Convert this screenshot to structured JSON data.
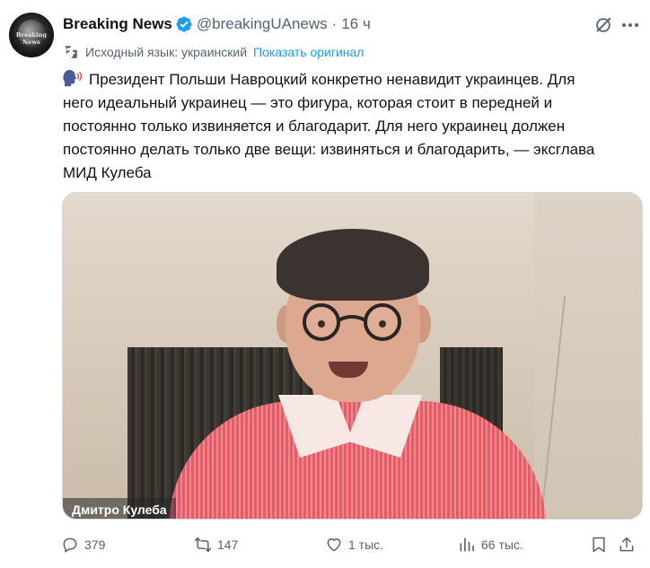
{
  "author": {
    "avatar_text": "Breaking News",
    "name": "Breaking News",
    "handle": "@breakingUAnews",
    "separator": "·",
    "time": "16 ч"
  },
  "translation": {
    "label": "Исходный язык: украинский",
    "show_original": "Показать оригинал"
  },
  "tweet": {
    "lines": [
      "Президент Польши Навроцкий конкретно ненавидит украинцев. Для",
      "него идеальный украинец — это фигура, которая стоит в передней и",
      "постоянно только извиняется и благодарит. Для него украинец должен",
      "постоянно делать только две вещи: извиняться и благодарить, — экс­глава",
      "МИД Кулеба"
    ]
  },
  "media": {
    "caption": "Дмитро Кулеба"
  },
  "actions": {
    "replies": "379",
    "reposts": "147",
    "likes": "1 тыс.",
    "views": "66 тыс."
  },
  "colors": {
    "text": "#0f1419",
    "secondary": "#536471",
    "link": "#1d9bf0",
    "verified": "#1d9bf0"
  }
}
